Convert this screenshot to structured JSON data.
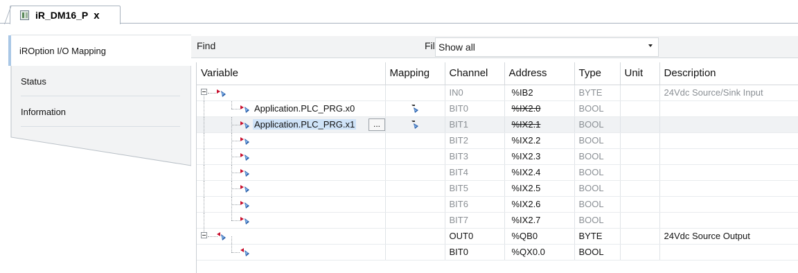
{
  "editor_tab": {
    "title": "iR_DM16_P",
    "close": "x"
  },
  "left_tabs": [
    {
      "label": "iROption I/O Mapping"
    },
    {
      "label": "Status"
    },
    {
      "label": "Information"
    }
  ],
  "findbar": {
    "find_label": "Find",
    "filter_label": "Filter",
    "filter_value": "Show all"
  },
  "table": {
    "columns": [
      "Variable",
      "Mapping",
      "Channel",
      "Address",
      "Type",
      "Unit",
      "Description"
    ],
    "rows": [
      {
        "variable": "",
        "mapping": "",
        "channel": "IN0",
        "address": "%IB2",
        "type": "BYTE",
        "unit": "",
        "description": "24Vdc Source/Sink Input"
      },
      {
        "variable": "Application.PLC_PRG.x0",
        "mapping": "mapped",
        "channel": "BIT0",
        "address": "%IX2.0",
        "type": "BOOL",
        "unit": "",
        "description": ""
      },
      {
        "variable": "Application.PLC_PRG.x1",
        "mapping": "mapped",
        "channel": "BIT1",
        "address": "%IX2.1",
        "type": "BOOL",
        "unit": "",
        "description": ""
      },
      {
        "variable": "",
        "mapping": "",
        "channel": "BIT2",
        "address": "%IX2.2",
        "type": "BOOL",
        "unit": "",
        "description": ""
      },
      {
        "variable": "",
        "mapping": "",
        "channel": "BIT3",
        "address": "%IX2.3",
        "type": "BOOL",
        "unit": "",
        "description": ""
      },
      {
        "variable": "",
        "mapping": "",
        "channel": "BIT4",
        "address": "%IX2.4",
        "type": "BOOL",
        "unit": "",
        "description": ""
      },
      {
        "variable": "",
        "mapping": "",
        "channel": "BIT5",
        "address": "%IX2.5",
        "type": "BOOL",
        "unit": "",
        "description": ""
      },
      {
        "variable": "",
        "mapping": "",
        "channel": "BIT6",
        "address": "%IX2.6",
        "type": "BOOL",
        "unit": "",
        "description": ""
      },
      {
        "variable": "",
        "mapping": "",
        "channel": "BIT7",
        "address": "%IX2.7",
        "type": "BOOL",
        "unit": "",
        "description": ""
      },
      {
        "variable": "",
        "mapping": "",
        "channel": "OUT0",
        "address": "%QB0",
        "type": "BYTE",
        "unit": "",
        "description": "24Vdc Source Output"
      },
      {
        "variable": "",
        "mapping": "",
        "channel": "BIT0",
        "address": "%QX0.0",
        "type": "BOOL",
        "unit": "",
        "description": ""
      }
    ],
    "ellipsis_label": "..."
  },
  "colors": {
    "selected_row": "#f0f2f4",
    "highlight_text": "#cfe3f8",
    "active_tab_accent": "#a9c7e6"
  },
  "icons": {
    "input_channel": "input-channel-icon",
    "output_channel": "output-channel-icon",
    "mapping": "mapping-icon"
  }
}
